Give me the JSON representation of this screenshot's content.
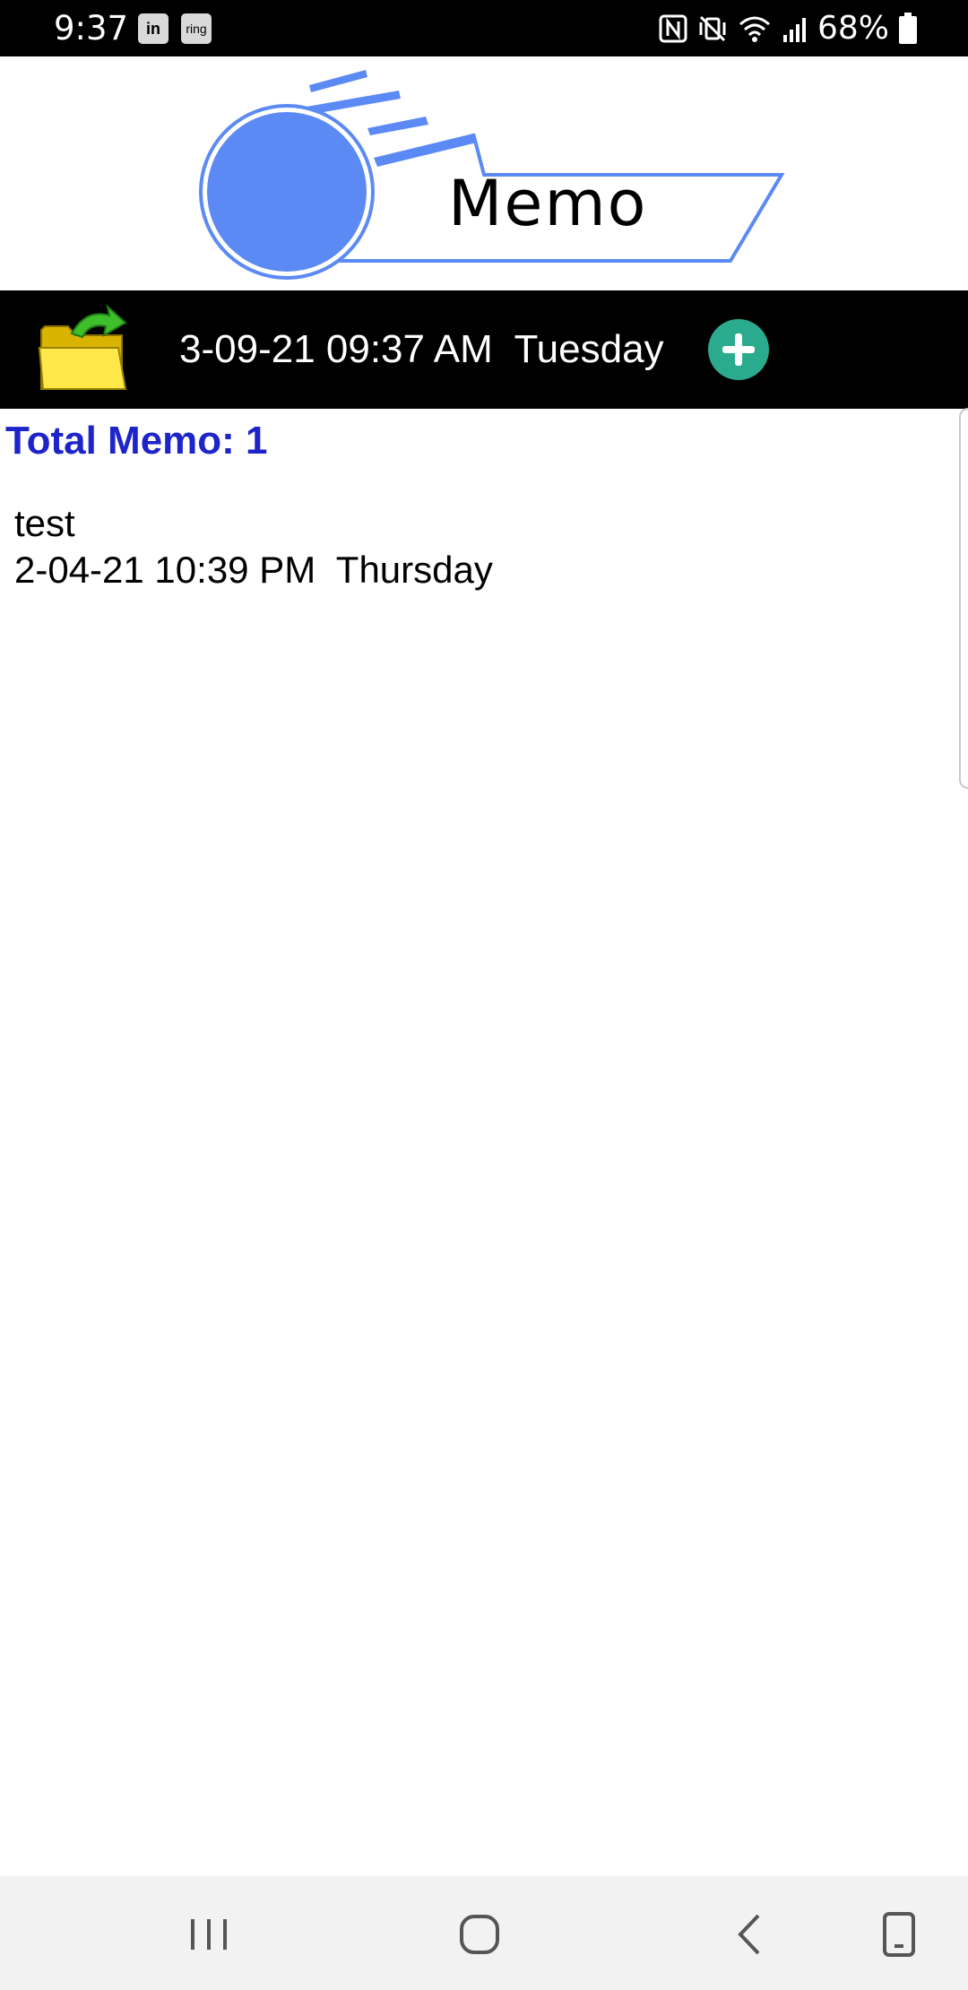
{
  "status_bar": {
    "time": "9:37",
    "left_icons": [
      "linkedin-icon",
      "ring-icon"
    ],
    "linkedin_label": "in",
    "ring_label": "ring",
    "right_icons": [
      "nfc-icon",
      "vibrate-mute-icon",
      "wifi-icon",
      "signal-icon",
      "battery-icon"
    ],
    "battery": "68%"
  },
  "header": {
    "logo_text": "Memo",
    "logo_color": "#5b8af5"
  },
  "toolbar": {
    "open_icon": "folder-open-icon",
    "datetime": "3-09-21 09:37 AM  Tuesday",
    "add_icon": "plus-circle-icon",
    "add_color": "#2bab8d"
  },
  "main": {
    "total_label": "Total Memo: 1",
    "total_color": "#1d24c9",
    "memos": [
      {
        "title": "test",
        "date": "2-04-21 10:39 PM  Thursday"
      }
    ]
  },
  "nav_bar": {
    "buttons": [
      "recent-apps-icon",
      "home-icon",
      "back-icon",
      "screen-rotate-icon"
    ]
  }
}
